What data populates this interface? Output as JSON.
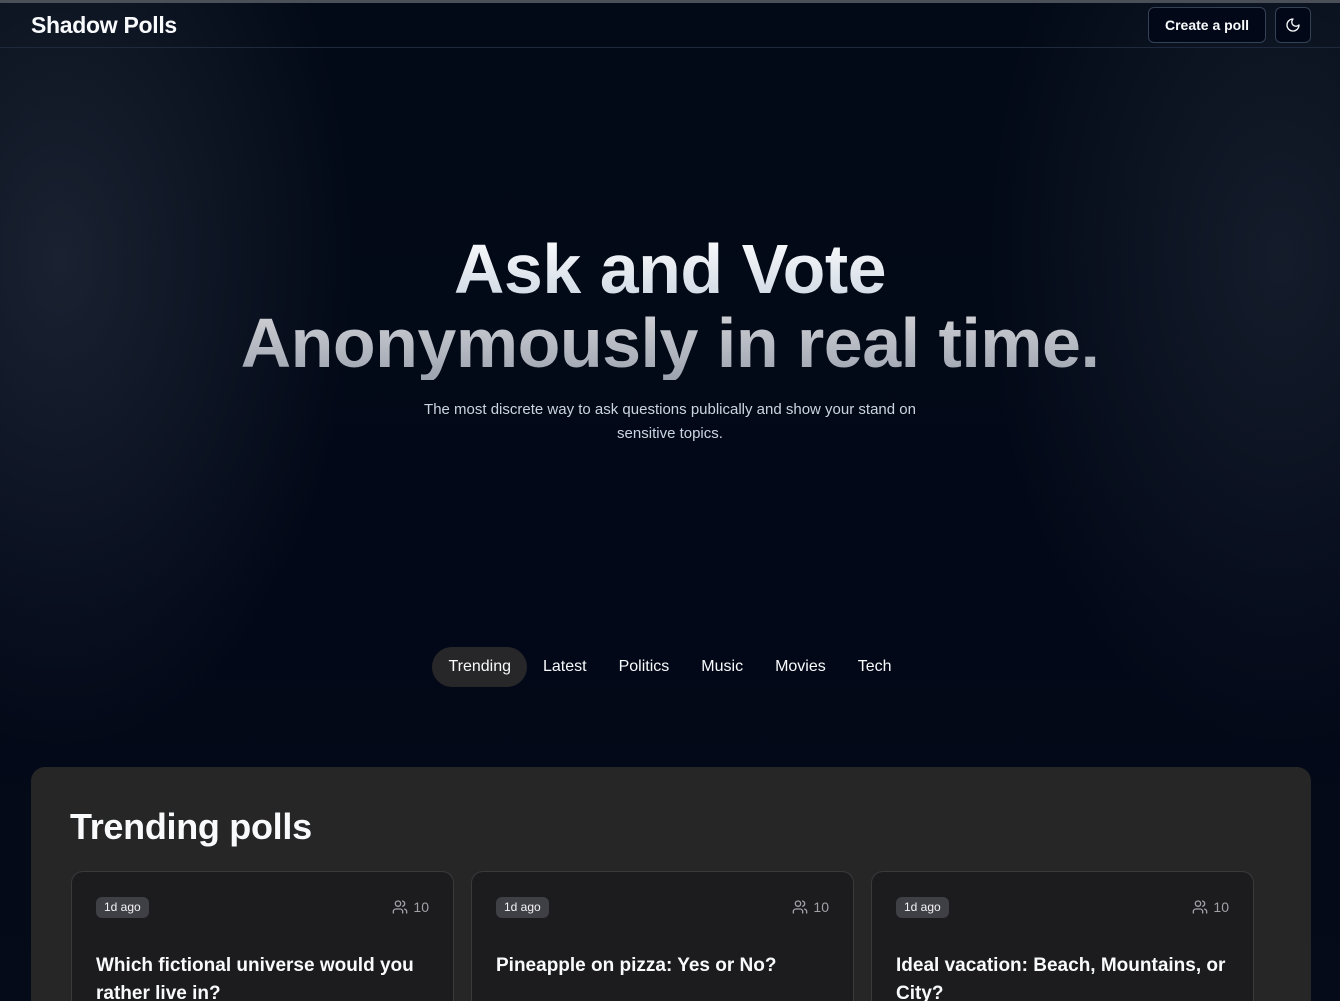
{
  "app": {
    "brand": "Shadow Polls"
  },
  "nav": {
    "create_label": "Create a poll",
    "theme_icon": "moon-icon"
  },
  "hero": {
    "line1": "Ask and Vote",
    "line2": "Anonymously in real time.",
    "subtitle": "The most discrete way to ask questions publically and show your stand on sensitive topics."
  },
  "tabs": [
    {
      "label": "Trending",
      "active": true
    },
    {
      "label": "Latest",
      "active": false
    },
    {
      "label": "Politics",
      "active": false
    },
    {
      "label": "Music",
      "active": false
    },
    {
      "label": "Movies",
      "active": false
    },
    {
      "label": "Tech",
      "active": false
    }
  ],
  "section": {
    "title": "Trending polls"
  },
  "polls": [
    {
      "age": "1d ago",
      "votes": "10",
      "question": "Which fictional universe would you rather live in?"
    },
    {
      "age": "1d ago",
      "votes": "10",
      "question": "Pineapple on pizza: Yes or No?"
    },
    {
      "age": "1d ago",
      "votes": "10",
      "question": "Ideal vacation: Beach, Mountains, or City?"
    }
  ],
  "colors": {
    "background": "#020817",
    "panel": "#262626",
    "card": "#1c1c1e",
    "active_tab": "#27272a",
    "badge": "#3f3f46"
  }
}
